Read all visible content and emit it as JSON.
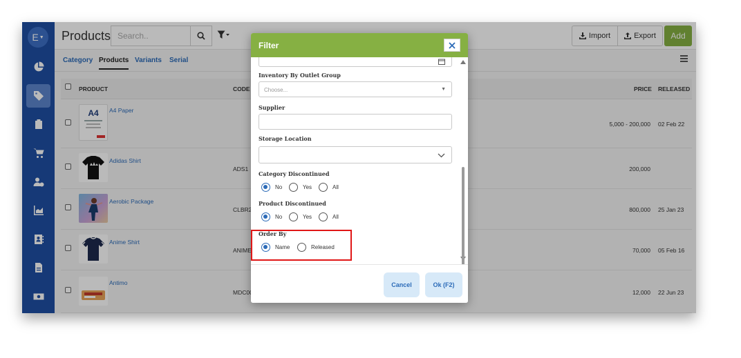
{
  "app": {
    "avatar_letter": "E",
    "title": "Products",
    "search_placeholder": "Search..",
    "import_label": "Import",
    "export_label": "Export",
    "add_label": "Add",
    "accent": "#86b043",
    "sidebar_color": "#1f4fa3"
  },
  "sidebar": {
    "items": [
      {
        "icon": "pie-chart-icon"
      },
      {
        "icon": "tag-icon",
        "active": true
      },
      {
        "icon": "clipboard-icon"
      },
      {
        "icon": "cart-icon"
      },
      {
        "icon": "users-icon"
      },
      {
        "icon": "bar-chart-icon"
      },
      {
        "icon": "contacts-icon"
      },
      {
        "icon": "document-icon"
      },
      {
        "icon": "cash-icon"
      }
    ]
  },
  "tabs": [
    {
      "label": "Category"
    },
    {
      "label": "Products",
      "active": true
    },
    {
      "label": "Variants"
    },
    {
      "label": "Serial"
    }
  ],
  "table": {
    "headers": {
      "product": "PRODUCT",
      "code": "CODE",
      "price": "PRICE",
      "released": "RELEASED"
    },
    "rows": [
      {
        "name": "A4 Paper",
        "code": "",
        "price": "5,000 - 200,000",
        "released": "02 Feb 22"
      },
      {
        "name": "Adidas Shirt",
        "code": "ADS1",
        "price": "200,000",
        "released": ""
      },
      {
        "name": "Aerobic Package",
        "code": "CLBR2",
        "price": "800,000",
        "released": "25 Jan 23"
      },
      {
        "name": "Anime Shirt",
        "code": "ANIME",
        "price": "70,000",
        "released": "05 Feb 16"
      },
      {
        "name": "Antimo",
        "code": "MDC00",
        "price": "12,000",
        "released": "22 Jun 23"
      }
    ],
    "a4_thumb_text": "A4"
  },
  "filter": {
    "title": "Filter",
    "outlet_group_label": "Inventory By Outlet Group",
    "outlet_group_value": "Choose...",
    "supplier_label": "Supplier",
    "supplier_value": "",
    "storage_label": "Storage Location",
    "storage_value": "",
    "category_disc_label": "Category Discontinued",
    "category_disc_options": [
      "No",
      "Yes",
      "All"
    ],
    "category_disc_selected": "No",
    "product_disc_label": "Product Discontinued",
    "product_disc_options": [
      "No",
      "Yes",
      "All"
    ],
    "product_disc_selected": "No",
    "order_by_label": "Order By",
    "order_by_options": [
      "Name",
      "Released"
    ],
    "order_by_selected": "Name",
    "cancel_label": "Cancel",
    "ok_label": "Ok (F2)"
  }
}
